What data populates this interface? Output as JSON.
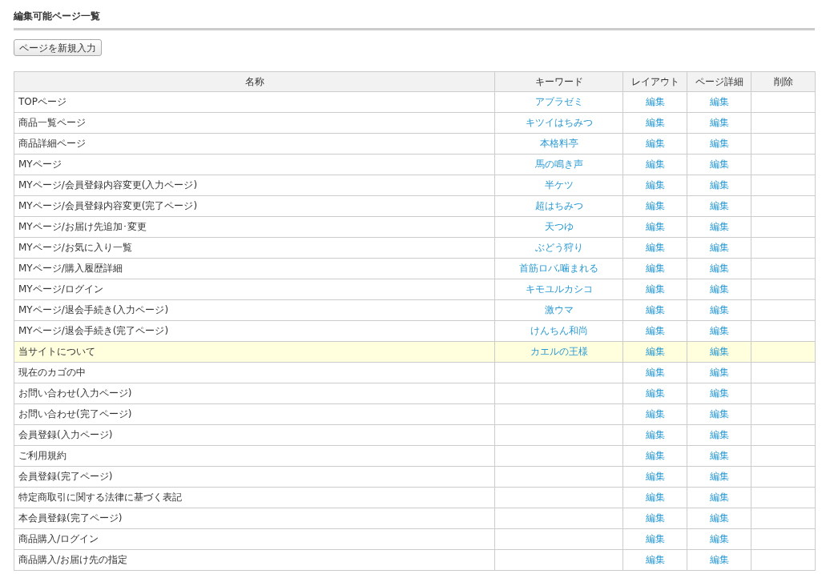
{
  "page_title": "編集可能ページ一覧",
  "new_button": "ページを新規入力",
  "table": {
    "columns": [
      "名称",
      "キーワード",
      "レイアウト",
      "ページ詳細",
      "削除"
    ],
    "rows": [
      {
        "name": "TOPページ",
        "keyword": "アブラゼミ",
        "layout": "編集",
        "detail": "編集",
        "highlighted": false
      },
      {
        "name": "商品一覧ページ",
        "keyword": "キツイはちみつ",
        "layout": "編集",
        "detail": "編集",
        "highlighted": false
      },
      {
        "name": "商品詳細ページ",
        "keyword": "本格料亭",
        "layout": "編集",
        "detail": "編集",
        "highlighted": false
      },
      {
        "name": "MYページ",
        "keyword": "馬の鳴き声",
        "layout": "編集",
        "detail": "編集",
        "highlighted": false
      },
      {
        "name": "MYページ/会員登録内容変更(入力ページ)",
        "keyword": "半ケツ",
        "layout": "編集",
        "detail": "編集",
        "highlighted": false
      },
      {
        "name": "MYページ/会員登録内容変更(完了ページ)",
        "keyword": "超はちみつ",
        "layout": "編集",
        "detail": "編集",
        "highlighted": false
      },
      {
        "name": "MYページ/お届け先追加･変更",
        "keyword": "天つゆ",
        "layout": "編集",
        "detail": "編集",
        "highlighted": false
      },
      {
        "name": "MYページ/お気に入り一覧",
        "keyword": "ぶどう狩り",
        "layout": "編集",
        "detail": "編集",
        "highlighted": false
      },
      {
        "name": "MYページ/購入履歴詳細",
        "keyword": "首筋ロバ,噛まれる",
        "layout": "編集",
        "detail": "編集",
        "highlighted": false
      },
      {
        "name": "MYページ/ログイン",
        "keyword": "キモユルカシコ",
        "layout": "編集",
        "detail": "編集",
        "highlighted": false
      },
      {
        "name": "MYページ/退会手続き(入力ページ)",
        "keyword": "激ウマ",
        "layout": "編集",
        "detail": "編集",
        "highlighted": false
      },
      {
        "name": "MYページ/退会手続き(完了ページ)",
        "keyword": "けんちん和尚",
        "layout": "編集",
        "detail": "編集",
        "highlighted": false
      },
      {
        "name": "当サイトについて",
        "keyword": "カエルの王様",
        "layout": "編集",
        "detail": "編集",
        "highlighted": true
      },
      {
        "name": "現在のカゴの中",
        "layout": "編集",
        "detail": "編集",
        "highlighted": false
      },
      {
        "name": "お問い合わせ(入力ページ)",
        "layout": "編集",
        "detail": "編集",
        "highlighted": false
      },
      {
        "name": "お問い合わせ(完了ページ)",
        "layout": "編集",
        "detail": "編集",
        "highlighted": false
      },
      {
        "name": "会員登録(入力ページ)",
        "layout": "編集",
        "detail": "編集",
        "highlighted": false
      },
      {
        "name": "ご利用規約",
        "layout": "編集",
        "detail": "編集",
        "highlighted": false
      },
      {
        "name": "会員登録(完了ページ)",
        "layout": "編集",
        "detail": "編集",
        "highlighted": false
      },
      {
        "name": "特定商取引に関する法律に基づく表記",
        "layout": "編集",
        "detail": "編集",
        "highlighted": false
      },
      {
        "name": "本会員登録(完了ページ)",
        "layout": "編集",
        "detail": "編集",
        "highlighted": false
      },
      {
        "name": "商品購入/ログイン",
        "layout": "編集",
        "detail": "編集",
        "highlighted": false
      },
      {
        "name": "商品購入/お届け先の指定",
        "layout": "編集",
        "detail": "編集",
        "highlighted": false
      }
    ]
  }
}
